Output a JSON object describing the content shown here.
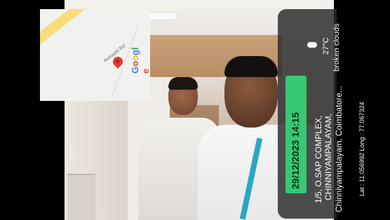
{
  "photo": {
    "scene": ""
  },
  "map": {
    "road_label": "Avinashi Rd",
    "brand": "Google",
    "brand_colors": [
      "#4285F4",
      "#EA4335",
      "#FBBC05",
      "#4285F4",
      "#34A853",
      "#EA4335"
    ]
  },
  "info": {
    "datetime": "29/12/2023 14:15",
    "address_line1": "1/5, O.SAP COMPLEX,",
    "address_line2": "CHINNIYAMPALAYAM,",
    "address_line3": "Chinniyampalayam, Coimbatore...",
    "coordinates": "Lat : 11.056992 Long : 77.067324",
    "temperature": "27°C",
    "weather": "broken clouds",
    "weather_icon": "cloud-icon",
    "accent_color": "#36c873"
  }
}
